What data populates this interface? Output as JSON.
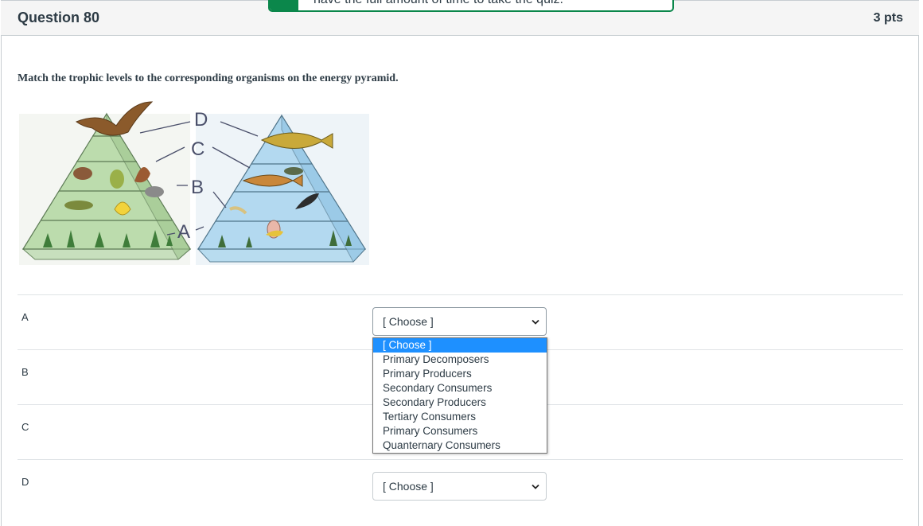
{
  "toast": {
    "message": "have the full amount of time to take the quiz."
  },
  "question": {
    "title": "Question 80",
    "points": "3 pts",
    "prompt": "Match the trophic levels to the corresponding organisms on the energy pyramid."
  },
  "diagram": {
    "labels": [
      "D",
      "C",
      "B",
      "A"
    ]
  },
  "rows": [
    {
      "label": "A",
      "value": "[ Choose ]"
    },
    {
      "label": "B",
      "value": ""
    },
    {
      "label": "C",
      "value": ""
    },
    {
      "label": "D",
      "value": "[ Choose ]"
    }
  ],
  "dropdown": {
    "options": [
      "[ Choose ]",
      "Primary Decomposers",
      "Primary Producers",
      "Secondary Consumers",
      "Secondary Producers",
      "Tertiary Consumers",
      "Primary Consumers",
      "Quanternary Consumers"
    ],
    "highlighted": 0
  },
  "colors": {
    "accent": "#0b874b",
    "highlight": "#1e90ff",
    "pyramid_land": "#a9d49a",
    "pyramid_water": "#9fd0ec"
  }
}
